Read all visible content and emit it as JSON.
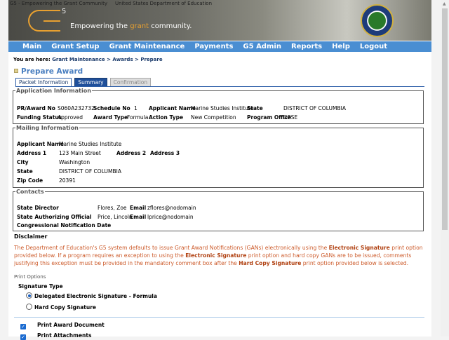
{
  "banner": {
    "alt1": "G5 - Empowering the Grant Community",
    "alt2": "United States Department of Education",
    "logo_sup": "5",
    "tagline_pre": "Empowering the ",
    "tagline_accent": "grant",
    "tagline_post": " community."
  },
  "nav": [
    "Main",
    "Grant Setup",
    "Grant Maintenance",
    "Payments",
    "G5 Admin",
    "Reports",
    "Help",
    "Logout"
  ],
  "breadcrumb": {
    "prefix": "You are here: ",
    "path": "Grant Maintenance > Awards > Prepare"
  },
  "page_title": "Prepare Award",
  "tabs": [
    "Packet Information",
    "Summary",
    "Confirmation"
  ],
  "application": {
    "legend": "Application Information",
    "pr_label": "PR/Award No",
    "pr": "S060A232732",
    "sched_label": "Schedule No",
    "sched": "1",
    "appname_label": "Applicant Name",
    "appname": "Marine Studies Institute",
    "state_label": "State",
    "state": "DISTRICT OF COLUMBIA",
    "fund_label": "Funding Status",
    "fund": "Approved",
    "atype_label": "Award Type",
    "atype": "Formula",
    "action_label": "Action Type",
    "action": "New Competition",
    "office_label": "Program Office",
    "office": "OESE"
  },
  "mailing": {
    "legend": "Mailing Information",
    "appname_label": "Applicant Name",
    "appname": "Marine Studies Institute",
    "addr1_label": "Address 1",
    "addr1": "123 Main Street",
    "addr2_label": "Address 2",
    "addr3_label": "Address 3",
    "city_label": "City",
    "city": "Washington",
    "state_label": "State",
    "state": "DISTRICT OF COLUMBIA",
    "zip_label": "Zip Code",
    "zip": "20391"
  },
  "contacts": {
    "legend": "Contacts",
    "dir_label": "State Director",
    "dir": "Flores, Zoe",
    "email_label": "Email",
    "dir_email": "zflores@nodomain",
    "auth_label": "State Authorizing Official",
    "auth": "Price, Lincoln",
    "auth_email": "lprice@nodomain",
    "cong_label": "Congressional Notification Date"
  },
  "disclaimer": {
    "heading": "Disclaimer",
    "t1": "The Department of Education's G5 system defaults to issue Grant Award Notifications (GANs) electronically using the ",
    "b1": "Electronic Signature",
    "t2": " print option provided below. If a program requires an exception to using the ",
    "b2": "Electronic Signature",
    "t3": " print option and hard copy GANs are to be issued, comments justifying this exception must be provided in the mandatory comment box after the ",
    "b3": "Hard Copy Signature",
    "t4": " print option provided below is selected."
  },
  "print": {
    "heading": "Print Options",
    "sig_type": "Signature Type",
    "opt1": "Delegated Electronic Signature - Formula",
    "opt1_selected": true,
    "opt2": "Hard Copy Signature",
    "chk1": "Print Award Document",
    "chk1_checked": true,
    "chk2": "Print Attachments",
    "chk2_checked": true
  }
}
